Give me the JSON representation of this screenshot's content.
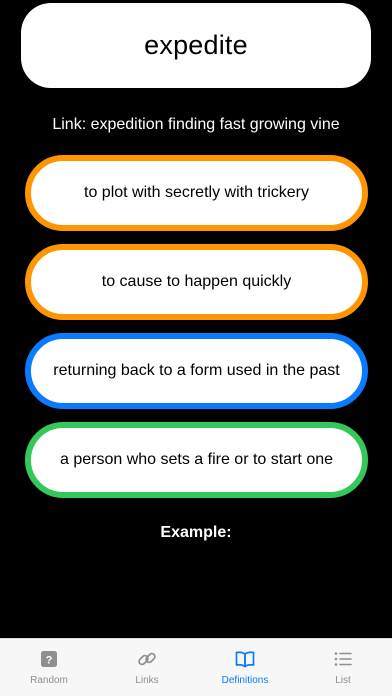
{
  "word": "expedite",
  "link_text": "Link: expedition finding fast growing vine",
  "options": [
    {
      "text": "to plot with secretly with trickery",
      "border_color": "#ff9500"
    },
    {
      "text": "to cause to happen quickly",
      "border_color": "#ff9500"
    },
    {
      "text": "returning back to a form used in the past",
      "border_color": "#0a7aff"
    },
    {
      "text": "a person who sets a fire or to start one",
      "border_color": "#34c759"
    }
  ],
  "example_label": "Example:",
  "tabs": [
    {
      "label": "Random",
      "icon": "question-square-icon",
      "active": false
    },
    {
      "label": "Links",
      "icon": "link-icon",
      "active": false
    },
    {
      "label": "Definitions",
      "icon": "book-icon",
      "active": true
    },
    {
      "label": "List",
      "icon": "list-icon",
      "active": false
    }
  ],
  "colors": {
    "active_tab": "#0a7aff",
    "inactive_tab": "#8e8e93",
    "orange": "#ff9500",
    "blue": "#0a7aff",
    "green": "#34c759"
  }
}
